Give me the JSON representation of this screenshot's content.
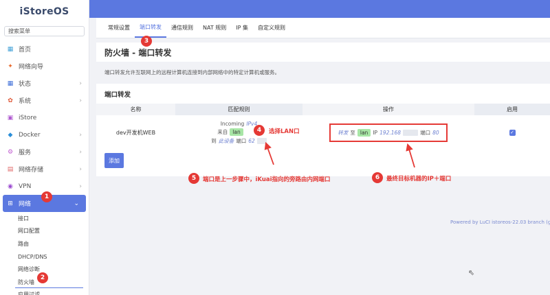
{
  "logo": "iStoreOS",
  "search_placeholder": "搜索菜单",
  "menu": [
    {
      "label": "首页",
      "icon": "home-icon",
      "glyph": "▦",
      "color": "#46a3d8",
      "chevron": ""
    },
    {
      "label": "网络向导",
      "icon": "wizard-icon",
      "glyph": "✦",
      "color": "#e8682a",
      "chevron": ""
    },
    {
      "label": "状态",
      "icon": "status-icon",
      "glyph": "▦",
      "color": "#3f6fd8",
      "chevron": "›"
    },
    {
      "label": "系统",
      "icon": "system-icon",
      "glyph": "✿",
      "color": "#e05a3a",
      "chevron": "›"
    },
    {
      "label": "iStore",
      "icon": "store-icon",
      "glyph": "▣",
      "color": "#b05ad0",
      "chevron": ""
    },
    {
      "label": "Docker",
      "icon": "docker-icon",
      "glyph": "◆",
      "color": "#2a8ed8",
      "chevron": "›"
    },
    {
      "label": "服务",
      "icon": "service-icon",
      "glyph": "⚙",
      "color": "#c05ad0",
      "chevron": "›"
    },
    {
      "label": "网络存储",
      "icon": "storage-icon",
      "glyph": "▤",
      "color": "#e06a6a",
      "chevron": "›"
    },
    {
      "label": "VPN",
      "icon": "vpn-icon",
      "glyph": "◉",
      "color": "#9b4ad0",
      "chevron": "›"
    },
    {
      "label": "网络",
      "icon": "network-icon",
      "glyph": "⊞",
      "color": "#ffffff",
      "chevron": "⌄"
    }
  ],
  "submenu": [
    "接口",
    "网口配置",
    "路由",
    "DHCP/DNS",
    "网络诊断",
    "防火墙",
    "应用过滤"
  ],
  "tabs": [
    "常规设置",
    "端口转发",
    "通信规则",
    "NAT 规则",
    "IP 集",
    "自定义规则"
  ],
  "page_title": "防火墙 - 端口转发",
  "description": "端口转发允许互联网上的远程计算机连接到内部网络中的特定计算机或服务。",
  "section_title": "端口转发",
  "columns": [
    "名称",
    "匹配规则",
    "操作",
    "启用"
  ],
  "rule": {
    "name": "dev开发机WEB",
    "incoming": "Incoming",
    "ipv": "IPv4",
    "from_label": "来自",
    "zone": "lan",
    "to_label": "到",
    "device": "此设备",
    "port_label": "端口",
    "port_partial": "62",
    "forward": "转发",
    "to": "至",
    "forward_zone": "lan",
    "ip_label": "IP",
    "ip_partial": "192.168",
    "dest_port_label": "端口",
    "dest_port": "80",
    "enabled_mark": "✓"
  },
  "add_button": "添加",
  "annotations": {
    "b1": "1",
    "b2": "2",
    "b3": "3",
    "b4": "4",
    "b5": "5",
    "b6": "6",
    "n4": "选择LAN口",
    "n5": "端口是上一步骤中，iKuai指向的旁路由内网端口",
    "n6": "最终目标机器的IP＋端口"
  },
  "footer": "Powered by LuCI istoreos-22.03 branch (git-23",
  "accent": "#5b78e0",
  "annotation_color": "#e53935"
}
